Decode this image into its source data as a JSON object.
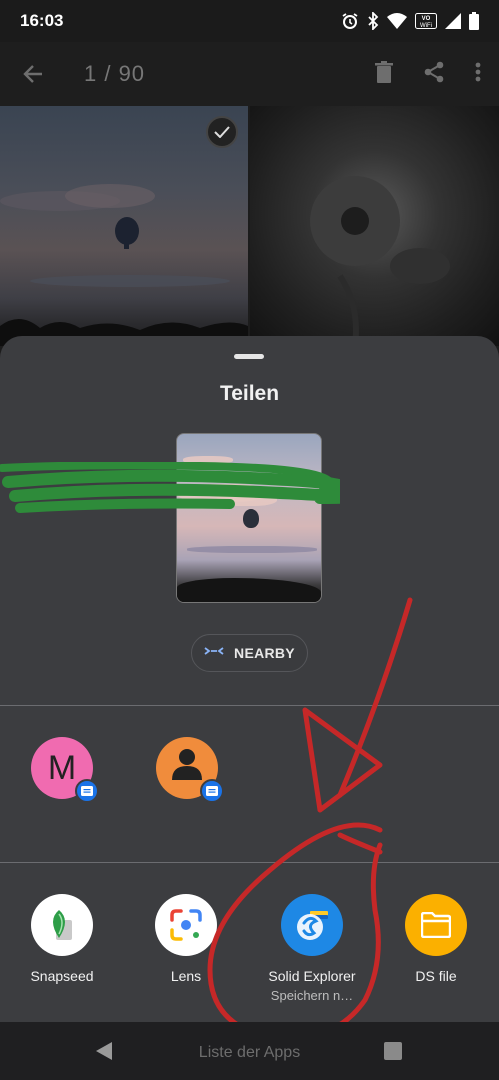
{
  "status_bar": {
    "time": "16:03",
    "icons": [
      "alarm-icon",
      "bluetooth-icon",
      "wifi-icon",
      "vowifi-icon",
      "signal-icon",
      "battery-icon"
    ],
    "vowifi_text": "VO WiFi"
  },
  "gallery": {
    "counter": "1 / 90",
    "icons": [
      "back-arrow-icon",
      "trash-icon",
      "share-icon",
      "more-vert-icon"
    ]
  },
  "share_sheet": {
    "title": "Teilen",
    "nearby_label": "NEARBY",
    "contacts": [
      {
        "initial": "M",
        "avatar_color": "#f06bb0",
        "badge": "message-icon"
      },
      {
        "initial": "",
        "avatar_color": "#f08c3c",
        "badge": "message-icon"
      }
    ],
    "apps": [
      {
        "name": "Snapseed",
        "sub": "",
        "icon": "snapseed-icon"
      },
      {
        "name": "Lens",
        "sub": "",
        "icon": "lens-icon"
      },
      {
        "name": "Solid Explorer",
        "sub": "Speichern n…",
        "icon": "solid-explorer-icon"
      },
      {
        "name": "DS file",
        "sub": "",
        "icon": "folder-icon"
      }
    ]
  },
  "navbar": {
    "label": "Liste der Apps",
    "icons": [
      "nav-back-icon",
      "nav-recents-icon"
    ]
  },
  "colors": {
    "sheet_bg": "#3c3d40",
    "annotation_red": "#c62828",
    "scribble_green": "#2e8b3a"
  }
}
